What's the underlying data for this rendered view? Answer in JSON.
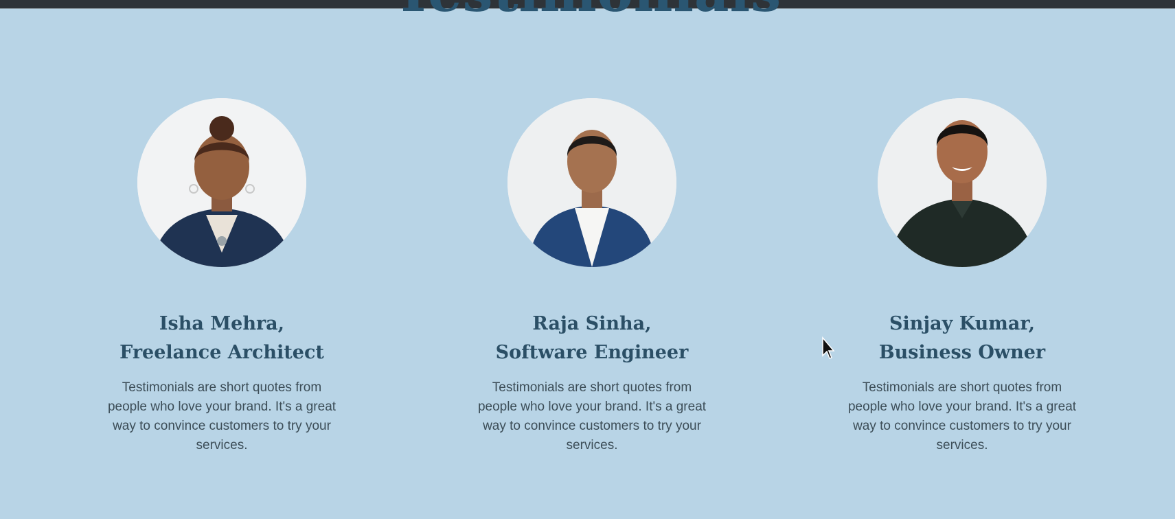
{
  "section": {
    "title": "Testimonials"
  },
  "testimonials": [
    {
      "name": "Isha Mehra,",
      "role": "Freelance Architect",
      "quote": "Testimonials are short quotes from people who love your brand. It's a great way to convince customers to try your services."
    },
    {
      "name": "Raja Sinha,",
      "role": "Software Engineer",
      "quote": "Testimonials are short quotes from people who love your brand. It's a great way to convince customers to try your services."
    },
    {
      "name": "Sinjay Kumar,",
      "role": "Business Owner",
      "quote": "Testimonials are short quotes from people who love your brand. It's a great way to convince customers to try your services."
    }
  ],
  "colors": {
    "background": "#b8d4e6",
    "heading": "#2b4f66",
    "body_text": "#3c4d57"
  }
}
